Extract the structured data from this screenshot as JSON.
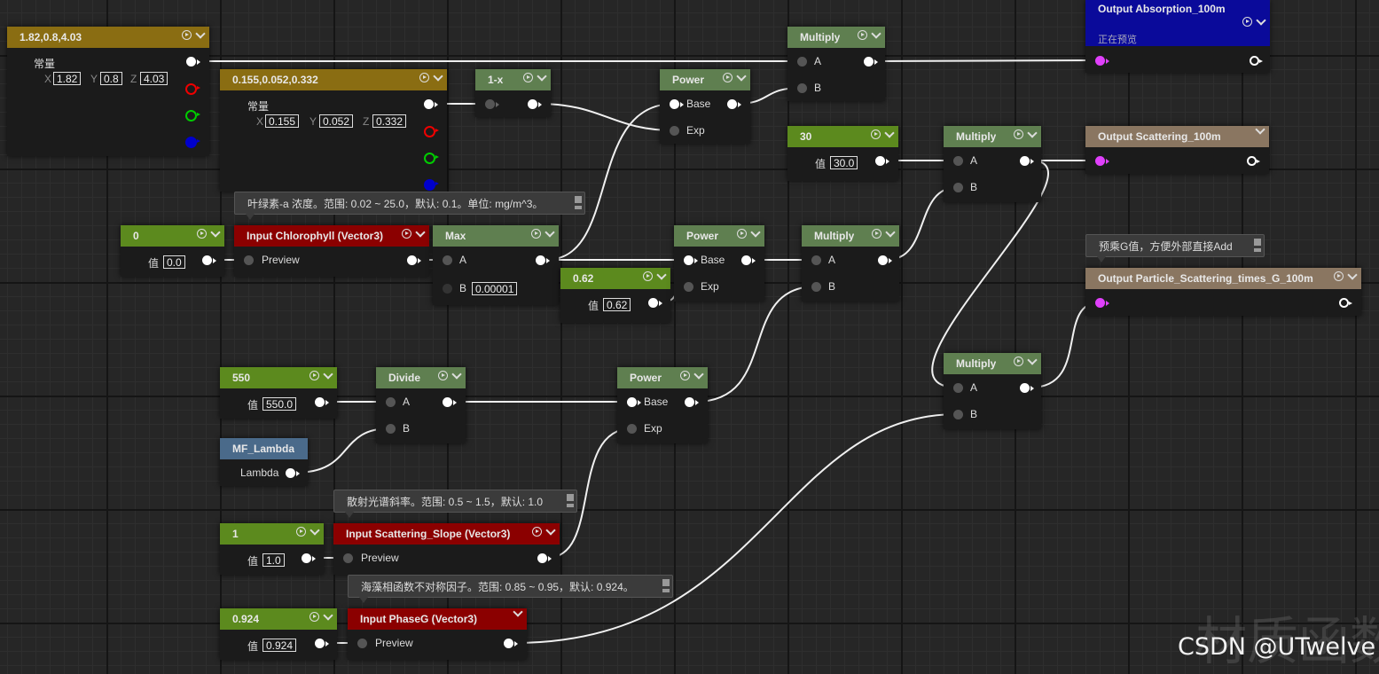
{
  "colors": {
    "constant": "#8a6d12",
    "scalar": "#5c8a1e",
    "math": "#5f7f50",
    "input": "#8b0000",
    "output_absorption": "#0a0a9a",
    "output": "#8a7661",
    "function": "#4a6a8a"
  },
  "nodes": {
    "const_a": {
      "title": "1.82,0.8,4.03",
      "label": "常量",
      "x": "1.82",
      "y": "0.8",
      "z": "4.03"
    },
    "const_b": {
      "title": "0.155,0.052,0.332",
      "label": "常量",
      "x": "0.155",
      "y": "0.052",
      "z": "0.332"
    },
    "one_minus_x": {
      "title": "1-x"
    },
    "power_1": {
      "title": "Power",
      "base": "Base",
      "exp": "Exp"
    },
    "multiply_1": {
      "title": "Multiply",
      "a": "A",
      "b": "B"
    },
    "output_absorption": {
      "title": "Output Absorption_100m",
      "status": "正在预览"
    },
    "scalar_30": {
      "title": "30",
      "label": "值",
      "value": "30.0"
    },
    "multiply_2": {
      "title": "Multiply",
      "a": "A",
      "b": "B"
    },
    "output_scattering": {
      "title": "Output Scattering_100m"
    },
    "comment_chl": "叶绿素-a 浓度。范围: 0.02 ~ 25.0，默认: 0.1。单位: mg/m^3。",
    "scalar_0": {
      "title": "0",
      "label": "值",
      "value": "0.0"
    },
    "input_chl": {
      "title": "Input Chlorophyll (Vector3)",
      "preview": "Preview"
    },
    "max": {
      "title": "Max",
      "a": "A",
      "b": "B",
      "b_value": "0.00001"
    },
    "scalar_062": {
      "title": "0.62",
      "label": "值",
      "value": "0.62"
    },
    "power_2": {
      "title": "Power",
      "base": "Base",
      "exp": "Exp"
    },
    "multiply_3": {
      "title": "Multiply",
      "a": "A",
      "b": "B"
    },
    "comment_g": "预乘G值，方便外部直接Add",
    "output_particle": {
      "title": "Output Particle_Scattering_times_G_100m"
    },
    "scalar_550": {
      "title": "550",
      "label": "值",
      "value": "550.0"
    },
    "divide": {
      "title": "Divide",
      "a": "A",
      "b": "B"
    },
    "power_3": {
      "title": "Power",
      "base": "Base",
      "exp": "Exp"
    },
    "multiply_4": {
      "title": "Multiply",
      "a": "A",
      "b": "B"
    },
    "mf_lambda": {
      "title": "MF_Lambda",
      "output": "Lambda"
    },
    "comment_slope": "散射光谱斜率。范围: 0.5 ~ 1.5，默认: 1.0",
    "scalar_1": {
      "title": "1",
      "label": "值",
      "value": "1.0"
    },
    "input_slope": {
      "title": "Input Scattering_Slope (Vector3)",
      "preview": "Preview"
    },
    "comment_phase": "海藻相函数不对称因子。范围: 0.85 ~ 0.95，默认: 0.924。",
    "scalar_0924": {
      "title": "0.924",
      "label": "值",
      "value": "0.924"
    },
    "input_phase": {
      "title": "Input PhaseG (Vector3)",
      "preview": "Preview"
    }
  },
  "watermark": "材质函数",
  "csdn_watermark": "CSDN @UTwelve"
}
